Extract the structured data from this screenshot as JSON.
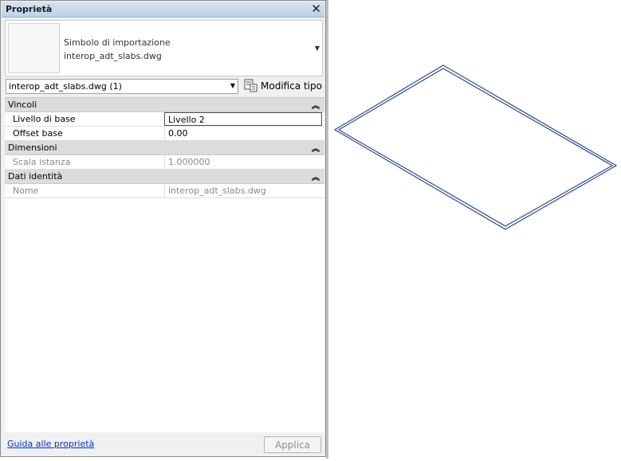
{
  "palette": {
    "title": "Proprietà",
    "close_glyph": "✕"
  },
  "type_selector": {
    "family": "Simbolo di importazione",
    "type_name": "interop_adt_slabs.dwg"
  },
  "instance_filter": {
    "value": "interop_adt_slabs.dwg (1)"
  },
  "edit_type": {
    "label": "Modifica tipo"
  },
  "groups": [
    {
      "title": "Vincoli",
      "rows": [
        {
          "name": "Livello di base",
          "value": "Livello 2"
        },
        {
          "name": "Offset base",
          "value": "0.00"
        }
      ]
    },
    {
      "title": "Dimensioni",
      "rows": [
        {
          "name": "Scala istanza",
          "value": "1.000000"
        }
      ]
    },
    {
      "title": "Dati identità",
      "rows": [
        {
          "name": "Nome",
          "value": "interop_adt_slabs.dwg"
        }
      ]
    }
  ],
  "footer": {
    "help_link": "Guida alle proprietà",
    "apply_label": "Applica"
  },
  "icons": {
    "close": "close-icon",
    "dropdown": "chevron-down-icon",
    "edit_type": "edit-type-icon",
    "collapse": "double-chevron-up-icon"
  },
  "colors": {
    "title_bar": "#c7d8ec",
    "group_header": "#dcdcdc",
    "slab_outline": "#2b4d8c",
    "link": "#0033cc"
  }
}
